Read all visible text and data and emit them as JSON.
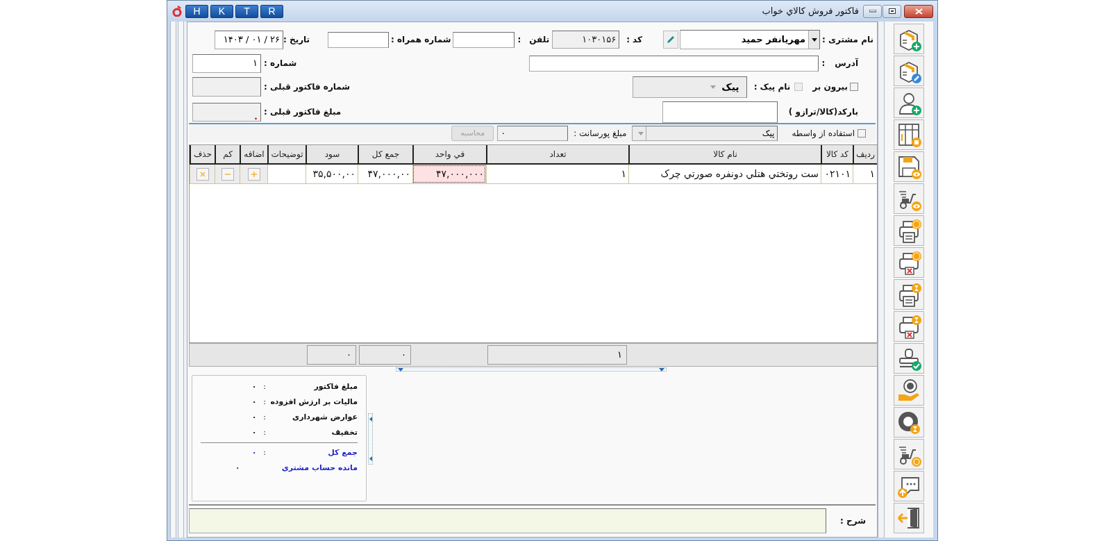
{
  "window": {
    "title": "فاکتور فروش کالاي خواب",
    "shortcut_buttons": [
      "R",
      "T",
      "K",
      "H"
    ]
  },
  "header": {
    "customer": {
      "label": "نام مشتری :",
      "value": "مهریانفر حمید"
    },
    "code": {
      "label": "کد :",
      "value": "۱۰۳۰۱۵۶"
    },
    "phone": {
      "label": "تلفن",
      "colon": ":"
    },
    "mobile": {
      "label": "شماره همراه :"
    },
    "date": {
      "label": "تاریخ :",
      "value": "۱۴۰۳ / ۰۱ / ۲۶"
    },
    "address": {
      "label": "آدرس",
      "colon": ":"
    },
    "number": {
      "label": "شماره :",
      "value": "۱"
    },
    "takeaway": {
      "label": "بیرون بر",
      "checked": false
    },
    "courier": {
      "label": "نام پیک :",
      "checked": false,
      "disabled": true,
      "value": "پیک"
    },
    "previous_invoice_number": {
      "label": "شماره فاکتور قبلی :"
    },
    "barcode": {
      "label": "بارکد(کالا/ترازو )"
    },
    "previous_invoice_amount": {
      "label": "مبلغ فاکتور قبلی :",
      "value": "."
    },
    "intermediary": {
      "label": "استفاده از واسطه",
      "checked": false,
      "value": "پیک"
    },
    "commission": {
      "label": "مبلغ پورسانت :",
      "value": "۰"
    },
    "calculate_button": {
      "label": "محاسبه",
      "disabled": true
    }
  },
  "table": {
    "columns": [
      {
        "label": "ردیف",
        "kind": "text"
      },
      {
        "label": "کد کالا",
        "kind": "text"
      },
      {
        "label": "نام کالا",
        "kind": "text"
      },
      {
        "label": "تعداد",
        "kind": "text"
      },
      {
        "label": "في واحد",
        "kind": "text"
      },
      {
        "label": "جمع کل",
        "kind": "text"
      },
      {
        "label": "سود",
        "kind": "text"
      },
      {
        "label": "توضیحات",
        "kind": "text"
      },
      {
        "label": "اضافه",
        "kind": "add"
      },
      {
        "label": "کم",
        "kind": "subtract"
      },
      {
        "label": "حذف",
        "kind": "delete"
      }
    ],
    "rows": [
      {
        "cells": [
          {
            "text": "۱",
            "selected": false
          },
          {
            "text": "۰۲۱۰۱",
            "selected": false
          },
          {
            "text": "ست روتختي هتلي دونفره صورتي چرک",
            "selected": false
          },
          {
            "text": "۱",
            "selected": false
          },
          {
            "text": "۴۷,۰۰۰,۰۰۰",
            "selected": true
          },
          {
            "text": "۴۷,۰۰۰,۰۰",
            "selected": false
          },
          {
            "text": "۳۵,۵۰۰,۰۰",
            "selected": false
          }
        ]
      }
    ],
    "totals": {
      "quantity": "۱",
      "total": "۰",
      "profit": "۰"
    }
  },
  "summary": [
    {
      "label": "مبلغ فاکتور",
      "colon": ":",
      "value": "۰",
      "kind": "normal"
    },
    {
      "label": "مالیات بر ارزش افزوده",
      "colon": ":",
      "value": "۰",
      "kind": "normal"
    },
    {
      "label": "عوارض شهرداری",
      "colon": ":",
      "value": "۰",
      "kind": "normal"
    },
    {
      "label": "تخفیف",
      "colon": ":",
      "value": "۰",
      "kind": "normal"
    },
    {
      "label": "جمع کل",
      "colon": ":",
      "value": "۰",
      "kind": "total"
    },
    {
      "label": "مانده حساب مشتری",
      "value": "۰",
      "kind": "total"
    }
  ],
  "description": {
    "label": "شرح :"
  }
}
